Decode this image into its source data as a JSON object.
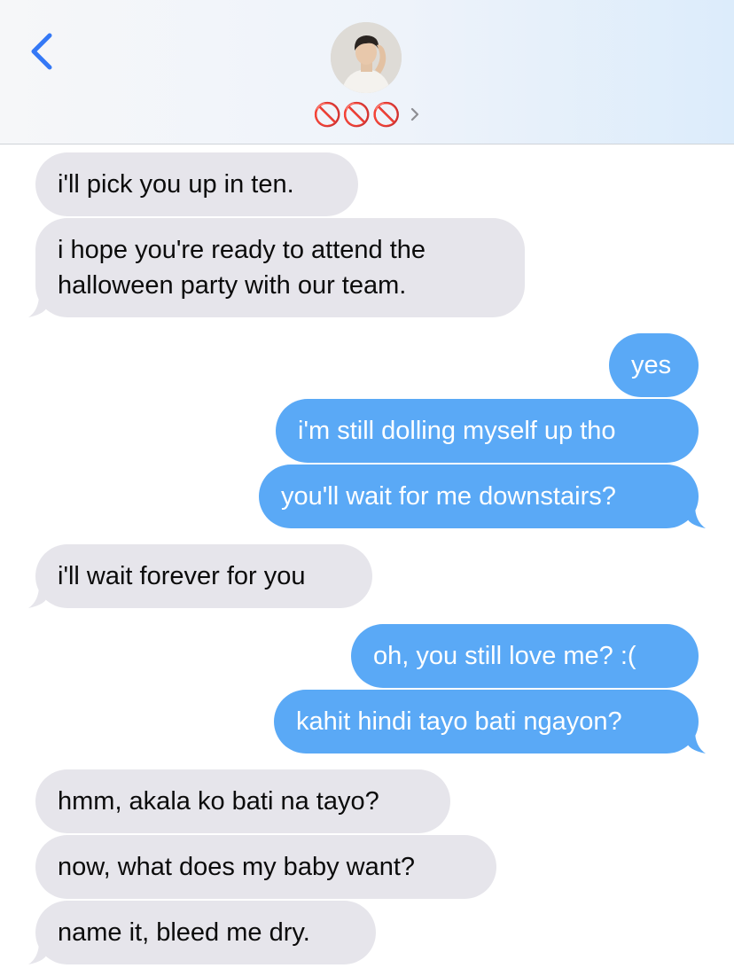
{
  "header": {
    "contact_name": "🚫🚫🚫",
    "back_icon": "chevron-left-icon",
    "info_icon": "chevron-right-icon",
    "accent_color": "#3478f6"
  },
  "colors": {
    "incoming_bubble": "#e6e5eb",
    "outgoing_bubble": "#5aa9f6"
  },
  "messages": [
    {
      "direction": "incoming",
      "text": "i'll pick you up in ten."
    },
    {
      "direction": "incoming",
      "text": "i hope you're ready to attend the\nhalloween party with our team."
    },
    {
      "direction": "outgoing",
      "text": "yes"
    },
    {
      "direction": "outgoing",
      "text": "i'm still dolling myself up tho"
    },
    {
      "direction": "outgoing",
      "text": "you'll wait for me downstairs?"
    },
    {
      "direction": "incoming",
      "text": "i'll wait forever for you"
    },
    {
      "direction": "outgoing",
      "text": "oh, you still love me? :("
    },
    {
      "direction": "outgoing",
      "text": "kahit hindi tayo bati ngayon?"
    },
    {
      "direction": "incoming",
      "text": "hmm, akala ko bati na tayo?"
    },
    {
      "direction": "incoming",
      "text": "now, what does my baby want?"
    },
    {
      "direction": "incoming",
      "text": "name it, bleed me dry."
    }
  ]
}
